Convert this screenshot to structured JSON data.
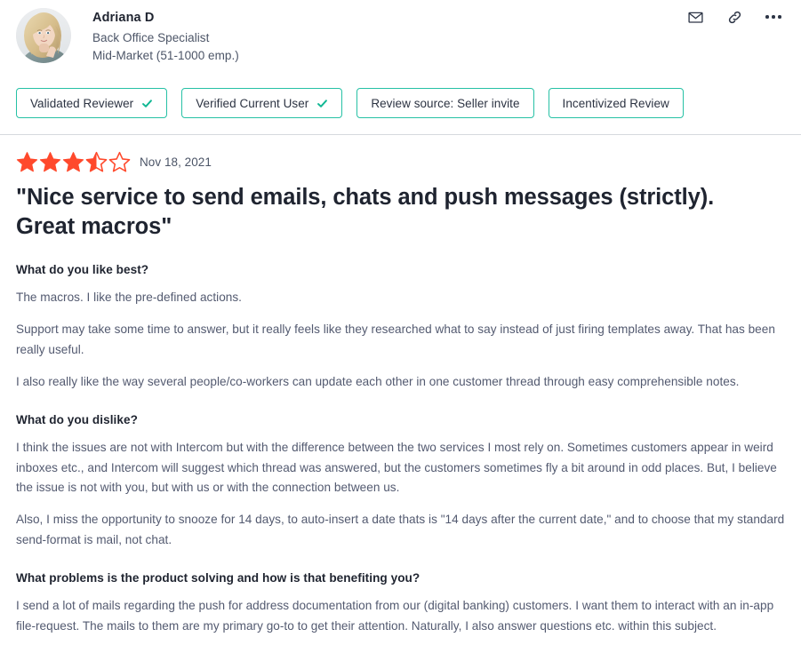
{
  "reviewer": {
    "name": "Adriana D",
    "role": "Back Office Specialist",
    "segment": "Mid-Market (51-1000 emp.)",
    "avatar_alt": "reviewer-avatar-photo"
  },
  "header_actions": [
    {
      "name": "email-icon",
      "label": "Email"
    },
    {
      "name": "link-icon",
      "label": "Copy link"
    },
    {
      "name": "more-options-icon",
      "label": "More options"
    }
  ],
  "badges": [
    {
      "label": "Validated Reviewer",
      "check": true
    },
    {
      "label": "Verified Current User",
      "check": true
    },
    {
      "label": "Review source: Seller invite",
      "check": false
    },
    {
      "label": "Incentivized Review",
      "check": false
    }
  ],
  "rating": {
    "value": 3.5,
    "max": 5,
    "date": "Nov 18, 2021",
    "star_color": "#FF492C"
  },
  "review": {
    "title": "\"Nice service to send emails, chats and push messages (strictly). Great macros\""
  },
  "qa": [
    {
      "question": "What do you like best?",
      "answers": [
        "The macros. I like the pre-defined actions.",
        "Support may take some time to answer, but it really feels like they researched what to say instead of just firing templates away. That has been really useful.",
        "I also really like the way several people/co-workers can update each other in one customer thread through easy comprehensible notes."
      ]
    },
    {
      "question": "What do you dislike?",
      "answers": [
        "I think the issues are not with Intercom but with the difference between the two services I most rely on. Sometimes customers appear in weird inboxes etc., and Intercom will suggest which thread was answered, but the customers sometimes fly a bit around in odd places. But, I believe the issue is not with you, but with us or with the connection between us.",
        "Also, I miss the opportunity to snooze for 14 days, to auto-insert a date thats is \"14 days after the current date,\" and to choose that my standard send-format is mail, not chat."
      ]
    },
    {
      "question": "What problems is the product solving and how is that benefiting you?",
      "answers": [
        "I send a lot of mails regarding the push for address documentation from our (digital banking) customers. I want them to interact with an in-app file-request. The mails to them are my primary go-to to get their attention. Naturally, I also answer questions etc. within this subject."
      ]
    }
  ],
  "colors": {
    "badge_border": "#26c1a5",
    "check": "#10b793",
    "heading": "#1f2430",
    "body": "#535a70",
    "divider": "#d6d9de"
  }
}
